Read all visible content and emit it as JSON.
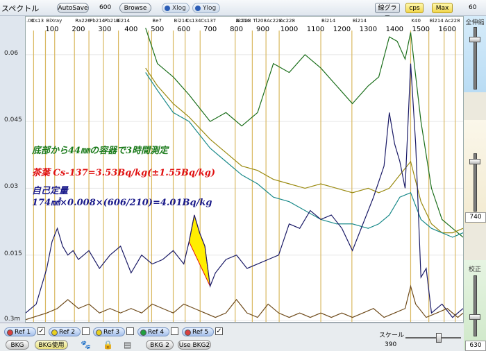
{
  "window": {
    "title": "スペクトル"
  },
  "toolbar": {
    "autosave_label": "AutoSave",
    "autosave_value": "600",
    "browse_label": "Browse",
    "xlog_label": "Xlog",
    "ylog_label": "Ylog",
    "linegraph_label": "線グラフ",
    "cps_label": "cps",
    "max_label": "Max",
    "top_right_value": "60"
  },
  "right_panel": {
    "zenshin_label": "全伸縮",
    "height_label": "高さ",
    "height_value": "740",
    "calib_label": "校正",
    "calib_value": "630"
  },
  "bottom": {
    "refs": [
      {
        "label": "Ref 1",
        "checked": true,
        "color": "#d84040"
      },
      {
        "label": "Ref 2",
        "checked": false,
        "color": "#e8d020"
      },
      {
        "label": "Ref 3",
        "checked": false,
        "color": "#e8d020"
      },
      {
        "label": "Ref 4",
        "checked": false,
        "color": "#20a040"
      },
      {
        "label": "Ref 5",
        "checked": true,
        "color": "#d84040"
      }
    ],
    "bkg_label": "BKG",
    "bkg_use_label": "BKG使用",
    "bkg2_label": "BKG 2",
    "use_bkg2_label": "Use BKG2",
    "scale_label": "スケール",
    "scale_value": "390"
  },
  "chart_data": {
    "type": "line",
    "x_tick_labels": [
      "100",
      "200",
      "300",
      "400",
      "500",
      "600",
      "700",
      "800",
      "900",
      "1000",
      "1100",
      "1200",
      "1300",
      "1400",
      "1500",
      "1600"
    ],
    "x_tick_values": [
      100,
      200,
      300,
      400,
      500,
      600,
      700,
      800,
      900,
      1000,
      1100,
      1200,
      1300,
      1400,
      1500,
      1600
    ],
    "xlim": [
      0,
      1660
    ],
    "y_tick_labels": [
      "0.06",
      "0.045",
      "0.03",
      "0.015",
      "0.3m"
    ],
    "y_tick_values": [
      0.06,
      0.045,
      0.03,
      0.015,
      0.0003
    ],
    "ylim": [
      0,
      0.0648
    ],
    "nuclide_labels": [
      {
        "text": ".00",
        "x": 0
      },
      {
        "text": "Cs13",
        "x": 20
      },
      {
        "text": "BiXray",
        "x": 75
      },
      {
        "text": "Ra226",
        "x": 185
      },
      {
        "text": "Pb214",
        "x": 240
      },
      {
        "text": "Pb214",
        "x": 295
      },
      {
        "text": "Bi214",
        "x": 340
      },
      {
        "text": "Be7",
        "x": 478
      },
      {
        "text": "Bi214",
        "x": 560
      },
      {
        "text": "Cs134",
        "x": 605
      },
      {
        "text": "Cs137",
        "x": 662
      },
      {
        "text": "Ac228",
        "x": 795
      },
      {
        "text": "Bi214",
        "x": 795
      },
      {
        "text": "Tl208",
        "x": 860
      },
      {
        "text": "Ac228",
        "x": 912
      },
      {
        "text": "Ac228",
        "x": 962
      },
      {
        "text": "Bi214",
        "x": 1120
      },
      {
        "text": "Bi214",
        "x": 1238
      },
      {
        "text": "K40",
        "x": 1461
      },
      {
        "text": "Bi214",
        "x": 1530
      },
      {
        "text": "Ac228",
        "x": 1588
      }
    ],
    "roi_lines": [
      30,
      75,
      110,
      185,
      240,
      295,
      352,
      465,
      478,
      560,
      605,
      662,
      795,
      860,
      912,
      962,
      1120,
      1238,
      1461,
      1530,
      1588,
      1630
    ],
    "annotations": [
      {
        "text": "底部から44㎜の容器で3時間測定",
        "color": "#1a7a1a"
      },
      {
        "text": "茶葉  Cs-137=3.53Bq/kg(±1.55Bq/kg)",
        "color": "#e01010"
      },
      {
        "text": "自己定量",
        "color": "#1a1a8a"
      },
      {
        "text": "174㎟×0.008×(606/210)=4.01Bq/kg",
        "color": "#1a1a8a"
      }
    ],
    "peak_fill": {
      "x_from": 610,
      "x_to": 700,
      "color": "#ffee00"
    },
    "series": [
      {
        "color": "#1a6e1a",
        "x": [
          455,
          500,
          560,
          620,
          700,
          760,
          820,
          880,
          940,
          1000,
          1060,
          1120,
          1180,
          1240,
          1300,
          1340,
          1380,
          1410,
          1440,
          1461,
          1500,
          1540,
          1580,
          1620,
          1660
        ],
        "y": [
          0.066,
          0.058,
          0.055,
          0.051,
          0.045,
          0.047,
          0.044,
          0.047,
          0.058,
          0.056,
          0.06,
          0.057,
          0.053,
          0.049,
          0.053,
          0.055,
          0.064,
          0.063,
          0.059,
          0.065,
          0.045,
          0.03,
          0.023,
          0.021,
          0.019
        ]
      },
      {
        "color": "#9a8a10",
        "x": [
          455,
          500,
          560,
          620,
          700,
          760,
          820,
          880,
          940,
          1000,
          1060,
          1120,
          1180,
          1240,
          1300,
          1340,
          1380,
          1420,
          1461,
          1500,
          1540,
          1580,
          1620,
          1660
        ],
        "y": [
          0.057,
          0.053,
          0.049,
          0.046,
          0.041,
          0.038,
          0.035,
          0.034,
          0.032,
          0.031,
          0.03,
          0.031,
          0.03,
          0.029,
          0.03,
          0.029,
          0.03,
          0.033,
          0.036,
          0.027,
          0.022,
          0.02,
          0.02,
          0.021
        ]
      },
      {
        "color": "#1a8a8a",
        "x": [
          455,
          500,
          560,
          620,
          700,
          760,
          820,
          880,
          940,
          1000,
          1060,
          1120,
          1180,
          1240,
          1300,
          1340,
          1380,
          1420,
          1461,
          1500,
          1540,
          1580,
          1620,
          1660
        ],
        "y": [
          0.056,
          0.052,
          0.047,
          0.045,
          0.039,
          0.036,
          0.033,
          0.031,
          0.028,
          0.027,
          0.025,
          0.023,
          0.022,
          0.022,
          0.021,
          0.022,
          0.024,
          0.028,
          0.029,
          0.023,
          0.021,
          0.02,
          0.019,
          0.02
        ]
      },
      {
        "color": "#1a1a66",
        "x": [
          0,
          40,
          80,
          100,
          120,
          140,
          160,
          180,
          200,
          240,
          280,
          320,
          360,
          400,
          440,
          480,
          520,
          560,
          600,
          620,
          640,
          660,
          680,
          700,
          720,
          760,
          800,
          840,
          880,
          920,
          960,
          1000,
          1040,
          1080,
          1120,
          1160,
          1200,
          1240,
          1280,
          1320,
          1360,
          1380,
          1400,
          1420,
          1440,
          1461,
          1480,
          1500,
          1520,
          1540,
          1580,
          1620,
          1660
        ],
        "y": [
          0.002,
          0.004,
          0.012,
          0.018,
          0.021,
          0.017,
          0.015,
          0.016,
          0.014,
          0.016,
          0.012,
          0.015,
          0.017,
          0.011,
          0.015,
          0.013,
          0.014,
          0.016,
          0.013,
          0.018,
          0.024,
          0.02,
          0.017,
          0.008,
          0.011,
          0.014,
          0.015,
          0.012,
          0.013,
          0.014,
          0.015,
          0.022,
          0.021,
          0.025,
          0.023,
          0.024,
          0.021,
          0.016,
          0.022,
          0.028,
          0.035,
          0.047,
          0.04,
          0.036,
          0.03,
          0.058,
          0.04,
          0.01,
          0.012,
          0.002,
          0.004,
          0.001,
          0.003
        ]
      },
      {
        "color": "#6e4a1a",
        "x": [
          0,
          80,
          120,
          160,
          200,
          240,
          280,
          320,
          360,
          400,
          440,
          480,
          520,
          560,
          600,
          640,
          680,
          720,
          760,
          800,
          840,
          880,
          920,
          960,
          1000,
          1040,
          1080,
          1120,
          1160,
          1200,
          1240,
          1280,
          1320,
          1360,
          1400,
          1440,
          1461,
          1480,
          1520,
          1560,
          1600,
          1640,
          1660
        ],
        "y": [
          0.0005,
          0.002,
          0.003,
          0.005,
          0.003,
          0.004,
          0.002,
          0.003,
          0.002,
          0.003,
          0.002,
          0.004,
          0.003,
          0.002,
          0.004,
          0.003,
          0.002,
          0.001,
          0.002,
          0.005,
          0.002,
          0.001,
          0.004,
          0.002,
          0.001,
          0.002,
          0.001,
          0.002,
          0.001,
          0.002,
          0.001,
          0.002,
          0.003,
          0.001,
          0.002,
          0.003,
          0.008,
          0.004,
          0.001,
          0.002,
          0.003,
          0.001,
          0.002
        ]
      }
    ]
  }
}
